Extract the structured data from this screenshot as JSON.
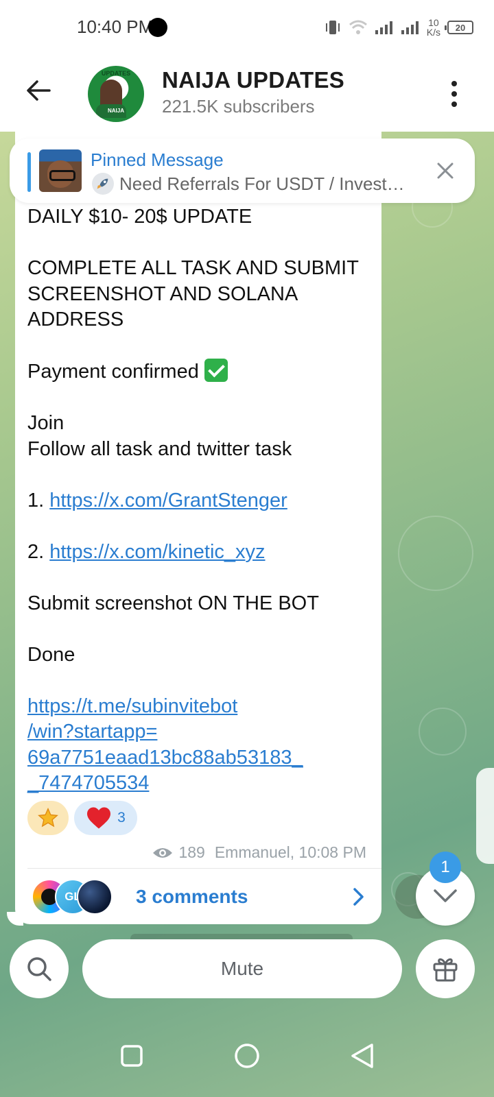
{
  "status_bar": {
    "time": "10:40 PM",
    "net_speed_value": "10",
    "net_speed_unit": "K/s",
    "battery": "20"
  },
  "header": {
    "channel_name": "NAIJA UPDATES",
    "subscribers": "221.5K subscribers",
    "avatar_text_top": "UPDATES",
    "avatar_text_badge": "NAIJA"
  },
  "pinned": {
    "title": "Pinned Message",
    "text": "Need Referrals For USDT / Invest…"
  },
  "message": {
    "line1": "DAILY $10- 20$ UPDATE",
    "line2": "COMPLETE ALL TASK AND SUBMIT SCREENSHOT AND SOLANA ADDRESS",
    "line3": "Payment confirmed",
    "line4": "Join",
    "line5": "Follow all task and twitter task",
    "item1_num": "1.",
    "item1_link": "https://x.com/GrantStenger",
    "item2_num": "2.",
    "item2_link": "https://x.com/kinetic_xyz",
    "line6": "Submit screenshot ON THE BOT",
    "line7": "Done",
    "bot_link": "https://t.me/subinvitebot\n/win?startapp=\n69a7751eaad13bc88ab53183_\n_7474705534",
    "reactions": [
      {
        "emoji": "star",
        "count": ""
      },
      {
        "emoji": "heart",
        "count": "3"
      }
    ],
    "views": "189",
    "author_time": "Emmanuel, 10:08 PM",
    "comments_label": "3 comments",
    "commenter_initials": "GL"
  },
  "floating": {
    "unread_count": "1"
  },
  "bottom_bar": {
    "mute_label": "Mute"
  },
  "colors": {
    "accent": "#2a7dd0",
    "pinned_line": "#3a9be6",
    "badge": "#3a9be6"
  }
}
